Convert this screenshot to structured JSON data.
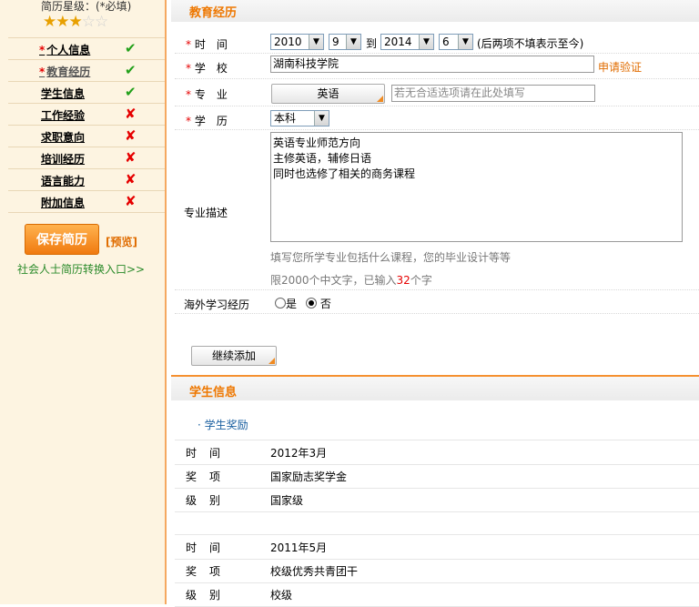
{
  "sidebar": {
    "rating_label": "简历星级：(*必填)",
    "stars_filled": "★★★",
    "stars_empty": "☆☆",
    "rating_value": 3,
    "rating_max": 5,
    "items": [
      {
        "label": "个人信息",
        "required": "*",
        "status": "✔"
      },
      {
        "label": "教育经历",
        "required": "*",
        "status": "✔"
      },
      {
        "label": "学生信息",
        "required": "",
        "status": "✔"
      },
      {
        "label": "工作经验",
        "required": "",
        "status": "✘"
      },
      {
        "label": "求职意向",
        "required": "",
        "status": "✘"
      },
      {
        "label": "培训经历",
        "required": "",
        "status": "✘"
      },
      {
        "label": "语言能力",
        "required": "",
        "status": "✘"
      },
      {
        "label": "附加信息",
        "required": "",
        "status": "✘"
      }
    ],
    "save_label": "保存简历",
    "preview_label": "[预览]",
    "convert_label": "社会人士简历转换入口>>"
  },
  "education": {
    "header": "教育经历",
    "time_label": "时　间",
    "time": {
      "start_year": "2010",
      "start_month": "9",
      "to": "到",
      "end_year": "2014",
      "end_month": "6",
      "note": "(后两项不填表示至今)"
    },
    "school_label": "学　校",
    "school_value": "湖南科技学院",
    "verify_label": "申请验证",
    "major_label": "专　业",
    "major_button": "英语",
    "major_placeholder": "若无合适选项请在此处填写",
    "degree_label": "学　历",
    "degree_value": "本科",
    "desc_label": "专业描述",
    "desc_lines": [
      "英语专业师范方向",
      "主修英语，辅修日语",
      "同时也选修了相关的商务课程"
    ],
    "desc_hint": "填写您所学专业包括什么课程，您的毕业设计等等",
    "limit_prefix": "限2000个中文字，已输入",
    "limit_count": "32",
    "limit_suffix": "个字",
    "overseas_label": "海外学习经历",
    "overseas_yes": "是",
    "overseas_no": "否",
    "add_more_label": "继续添加",
    "required_mark": "*"
  },
  "student": {
    "header": "学生信息",
    "awards_title": "· 学生奖励",
    "time_k1": "时",
    "time_k2": "间",
    "award_k1": "奖",
    "award_k2": "项",
    "level_k1": "级",
    "level_k2": "别",
    "awards": [
      {
        "time": "2012年3月",
        "award": "国家励志奖学金",
        "level": "国家级"
      },
      {
        "time": "2011年5月",
        "award": "校级优秀共青团干",
        "level": "校级"
      }
    ]
  }
}
